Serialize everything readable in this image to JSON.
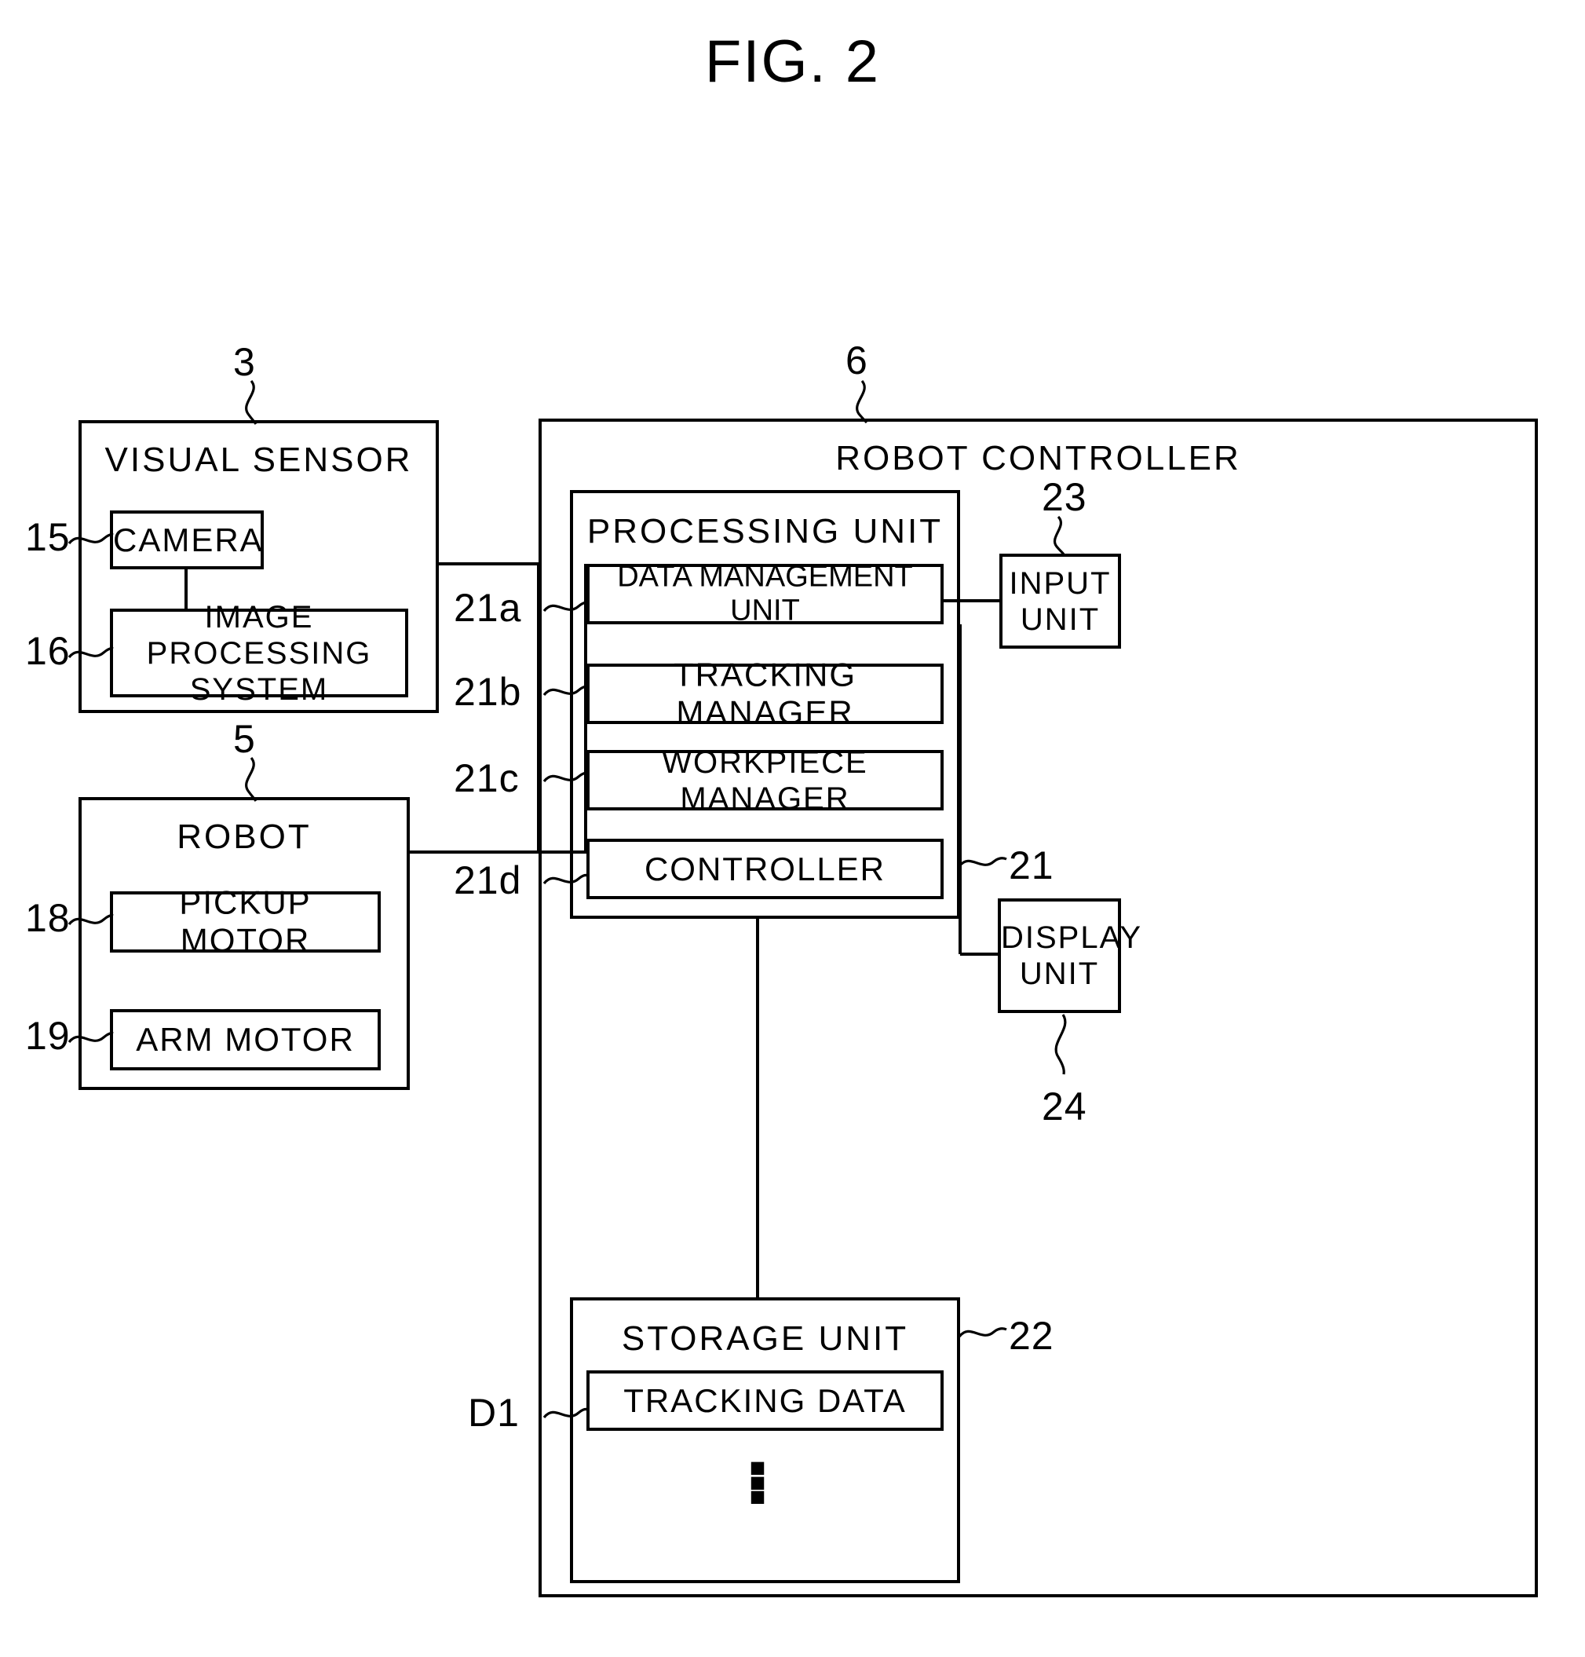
{
  "figure": {
    "title": "FIG. 2"
  },
  "blocks": {
    "visual_sensor": {
      "title": "VISUAL  SENSOR",
      "ref": "3",
      "children": [
        {
          "label": "CAMERA",
          "ref": "15"
        },
        {
          "label": "IMAGE  PROCESSING\nSYSTEM",
          "line1": "IMAGE  PROCESSING",
          "line2": "SYSTEM",
          "ref": "16"
        }
      ]
    },
    "robot": {
      "title": "ROBOT",
      "ref": "5",
      "children": [
        {
          "label": "PICKUP  MOTOR",
          "ref": "18"
        },
        {
          "label": "ARM  MOTOR",
          "ref": "19"
        }
      ]
    },
    "robot_controller": {
      "title": "ROBOT  CONTROLLER",
      "ref": "6",
      "processing_unit": {
        "title": "PROCESSING  UNIT",
        "ref": "21",
        "children": [
          {
            "label": "DATA  MANAGEMENT UNIT",
            "ref": "21a"
          },
          {
            "label": "TRACKING  MANAGER",
            "ref": "21b"
          },
          {
            "label": "WORKPIECE  MANAGER",
            "ref": "21c"
          },
          {
            "label": "CONTROLLER",
            "ref": "21d"
          }
        ]
      },
      "storage_unit": {
        "title": "STORAGE  UNIT",
        "ref": "22",
        "children": [
          {
            "label": "TRACKING  DATA",
            "ref": "D1"
          }
        ],
        "continuation": "⋮"
      }
    },
    "input_unit": {
      "line1": "INPUT",
      "line2": "UNIT",
      "ref": "23"
    },
    "display_unit": {
      "line1": "DISPLAY",
      "line2": "UNIT",
      "ref": "24"
    }
  }
}
